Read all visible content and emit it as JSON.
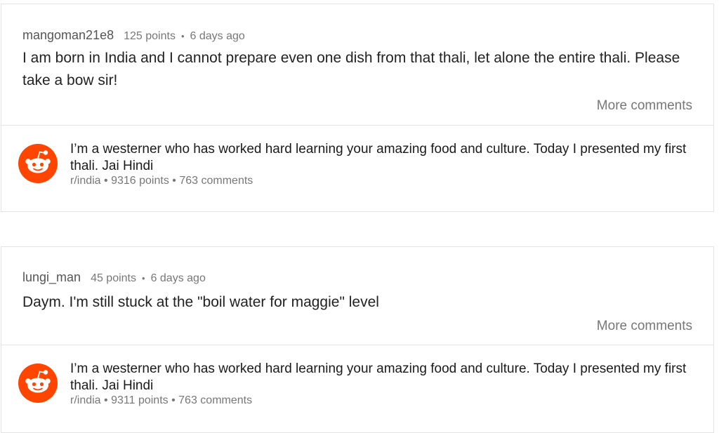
{
  "comments": [
    {
      "username": "mangoman21e8",
      "points": "125 points",
      "separator": "•",
      "age": "6 days ago",
      "body": "I am born in India and I cannot prepare even one dish from that thali, let alone the entire thali. Please take a bow sir!",
      "more_label": "More comments",
      "post": {
        "icon": "reddit-logo-icon",
        "title": "I’m a westerner who has worked hard learning your amazing food and culture. Today I presented my first thali. Jai Hindi",
        "subreddit": "r/india",
        "points": "9316 points",
        "comments": "763 comments",
        "separator": "•"
      }
    },
    {
      "username": "lungi_man",
      "points": "45 points",
      "separator": "•",
      "age": "6 days ago",
      "body": "Daym. I'm still stuck at the \"boil water for maggie\" level",
      "more_label": "More comments",
      "post": {
        "icon": "reddit-logo-icon",
        "title": "I’m a westerner who has worked hard learning your amazing food and culture. Today I presented my first thali. Jai Hindi",
        "subreddit": "r/india",
        "points": "9311 points",
        "comments": "763 comments",
        "separator": "•"
      }
    }
  ],
  "colors": {
    "reddit_orange": "#ff4500",
    "muted": "#777777",
    "border": "#e3e3e3"
  }
}
